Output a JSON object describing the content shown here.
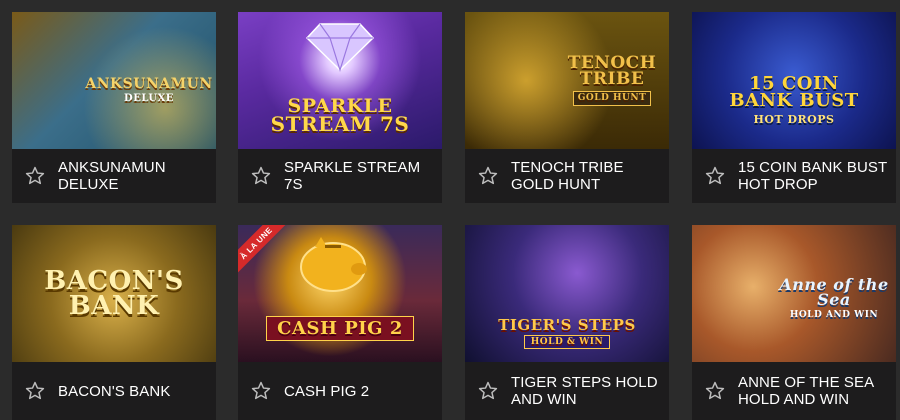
{
  "games": [
    {
      "title": "ANKSUNAMUN DELUXE",
      "logo_main": "ANKSUNAMUN",
      "logo_sub": "DELUXE",
      "logo_color": "#f5d36a"
    },
    {
      "title": "SPARKLE STREAM 7S",
      "logo_main": "SPARKLE",
      "logo_sub": "STREAM 7s",
      "logo_color": "#ffd84a"
    },
    {
      "title": "TENOCH TRIBE GOLD HUNT",
      "logo_main": "TENOCH TRIBE",
      "logo_sub": "GOLD HUNT",
      "logo_color": "#f1c04a"
    },
    {
      "title": "15 COIN BANK BUST HOT DROP",
      "logo_main": "15 COIN BANK BUST",
      "logo_sub": "HOT DROPS",
      "logo_color": "#ffd53a"
    },
    {
      "title": "BACON'S BANK",
      "logo_main": "BACON'S BANK",
      "logo_sub": "",
      "logo_color": "#fff1b0"
    },
    {
      "title": "CASH PIG 2",
      "logo_main": "CASH PIG 2",
      "logo_sub": "",
      "logo_color": "#ffd34a",
      "ribbon": "À LA UNE"
    },
    {
      "title": "TIGER STEPS HOLD AND WIN",
      "logo_main": "TIGER'S STEPS",
      "logo_sub": "HOLD & WIN",
      "logo_color": "#ffc94a"
    },
    {
      "title": "ANNE OF THE SEA HOLD AND WIN",
      "logo_main": "Anne of the Sea",
      "logo_sub": "HOLD AND WIN",
      "logo_color": "#e8f4ff"
    }
  ],
  "icons": {
    "favorite": "star-outline-icon"
  },
  "colors": {
    "page_bg": "#2b2b2b",
    "card_bar_bg": "#1d1c1d",
    "title_text": "#ffffff",
    "ribbon": "#d62a2a"
  }
}
